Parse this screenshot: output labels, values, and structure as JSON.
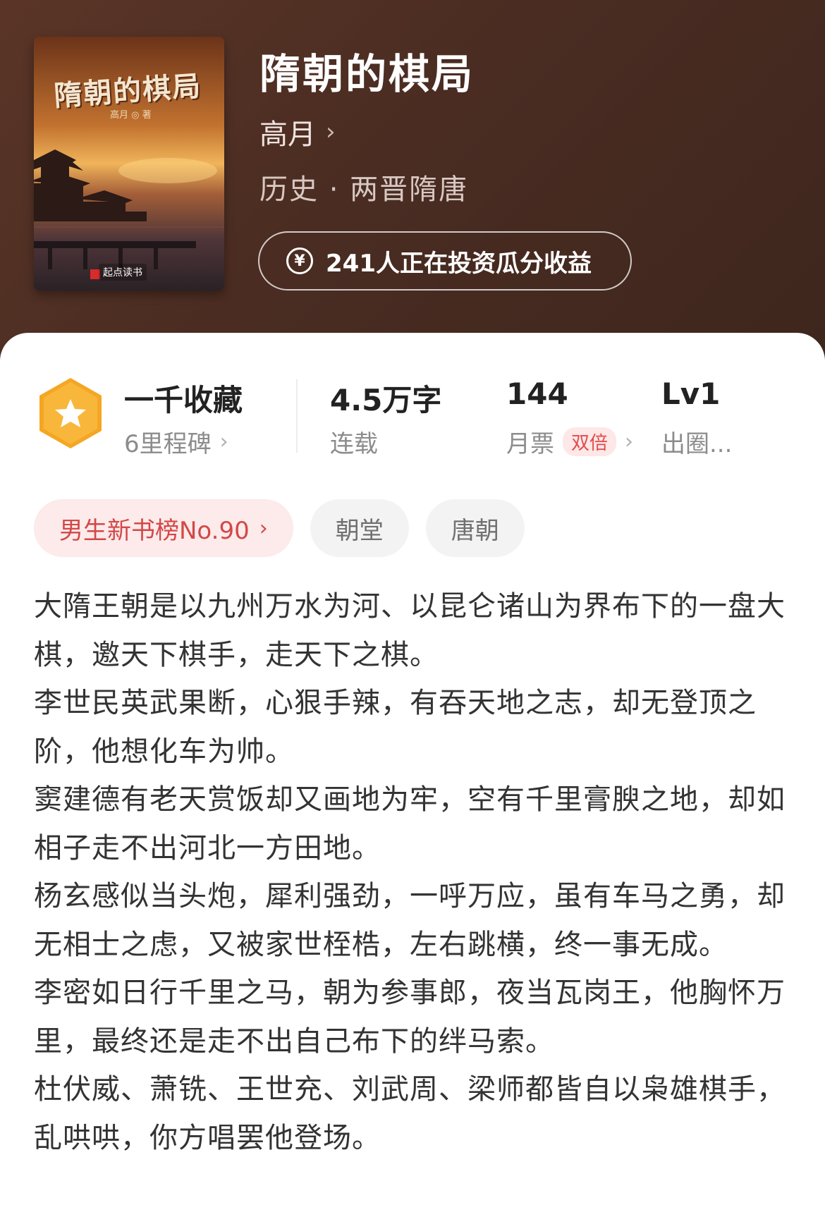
{
  "book": {
    "title": "隋朝的棋局",
    "author": "高月",
    "genre": "历史 · 两晋隋唐",
    "invest_text": "241人正在投资瓜分收益",
    "cover": {
      "title": "隋朝的棋局",
      "author": "高月 ◎ 著",
      "brand": "起点读书"
    }
  },
  "stats": {
    "collect": {
      "value": "一千收藏",
      "label": "6里程碑"
    },
    "words": {
      "value": "4.5万字",
      "label": "连载"
    },
    "tickets": {
      "value": "144",
      "label": "月票",
      "badge": "双倍"
    },
    "level": {
      "value": "Lv1",
      "label": "出圈..."
    }
  },
  "tags": {
    "rank": "男生新书榜No.90",
    "tag1": "朝堂",
    "tag2": "唐朝"
  },
  "description": [
    "大隋王朝是以九州万水为河、以昆仑诸山为界布下的一盘大棋，邀天下棋手，走天下之棋。",
    "李世民英武果断，心狠手辣，有吞天地之志，却无登顶之阶，他想化车为帅。",
    "窦建德有老天赏饭却又画地为牢，空有千里膏腴之地，却如相子走不出河北一方田地。",
    "杨玄感似当头炮，犀利强劲，一呼万应，虽有车马之勇，却无相士之虑，又被家世桎梏，左右跳横，终一事无成。",
    "李密如日行千里之马，朝为参事郎，夜当瓦岗王，他胸怀万里，最终还是走不出自己布下的绊马索。",
    "杜伏威、萧铣、王世充、刘武周、梁师都皆自以枭雄棋手，乱哄哄，你方唱罢他登场。"
  ],
  "colors": {
    "hero_bg": "#4a2c22",
    "badge": "#f5a623",
    "rank_tag_text": "#d24848"
  }
}
